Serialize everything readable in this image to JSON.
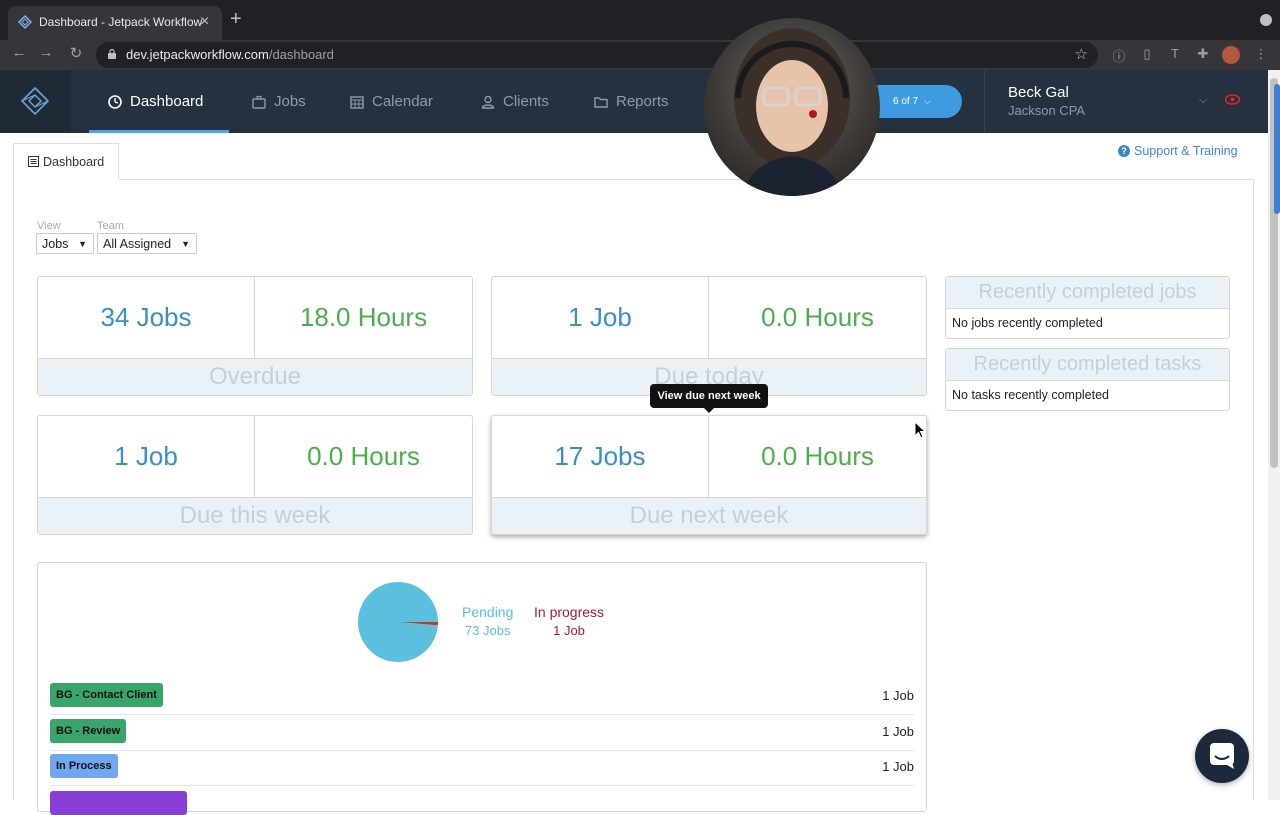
{
  "browser": {
    "tab_title": "Dashboard - Jetpack Workflow",
    "tab_close": "×",
    "new_tab": "+",
    "url_host": "dev.jetpackworkflow.com",
    "url_path": "/dashboard",
    "back": "←",
    "forward": "→",
    "reload": "↻",
    "star": "☆",
    "ext_icons": [
      "info-icon",
      "document-icon",
      "text-icon",
      "puzzle-icon"
    ]
  },
  "nav": {
    "items": [
      {
        "label": "Dashboard",
        "icon": "dashboard-icon",
        "active": true
      },
      {
        "label": "Jobs",
        "icon": "briefcase-icon"
      },
      {
        "label": "Calendar",
        "icon": "calendar-icon"
      },
      {
        "label": "Clients",
        "icon": "user-icon"
      },
      {
        "label": "Reports",
        "icon": "folder-icon"
      }
    ],
    "onboarding_pill": "6 of 7",
    "user_name": "Beck Gal",
    "firm_name": "Jackson CPA"
  },
  "page": {
    "tab_label": "Dashboard",
    "support_label": "Support & Training",
    "support_icon": "?"
  },
  "filters": {
    "view_label": "View",
    "view_value": "Jobs",
    "team_label": "Team",
    "team_value": "All Assigned",
    "caret": "▼"
  },
  "cards": [
    {
      "jobs": "34 Jobs",
      "hours": "18.0 Hours",
      "label": "Overdue"
    },
    {
      "jobs": "1 Job",
      "hours": "0.0 Hours",
      "label": "Due today"
    },
    {
      "jobs": "1 Job",
      "hours": "0.0 Hours",
      "label": "Due this week"
    },
    {
      "jobs": "17 Jobs",
      "hours": "0.0 Hours",
      "label": "Due next week"
    }
  ],
  "tooltip": "View due next week",
  "recent": {
    "jobs_title": "Recently completed jobs",
    "jobs_empty": "No jobs recently completed",
    "tasks_title": "Recently completed tasks",
    "tasks_empty": "No tasks recently completed"
  },
  "status_chart": {
    "pending_label": "Pending",
    "pending_value": "73 Jobs",
    "in_progress_label": "In progress",
    "in_progress_value": "1 Job",
    "pending_count": 73,
    "in_progress_count": 1,
    "pending_color": "#5bc0de",
    "in_progress_color": "#c0392b"
  },
  "status_rows": [
    {
      "label": "BG - Contact Client",
      "count": "1 Job",
      "color": "#3aa56b"
    },
    {
      "label": "BG - Review",
      "count": "1 Job",
      "color": "#3aa56b"
    },
    {
      "label": "In Process",
      "count": "1 Job",
      "color": "#6fa8f0"
    }
  ]
}
